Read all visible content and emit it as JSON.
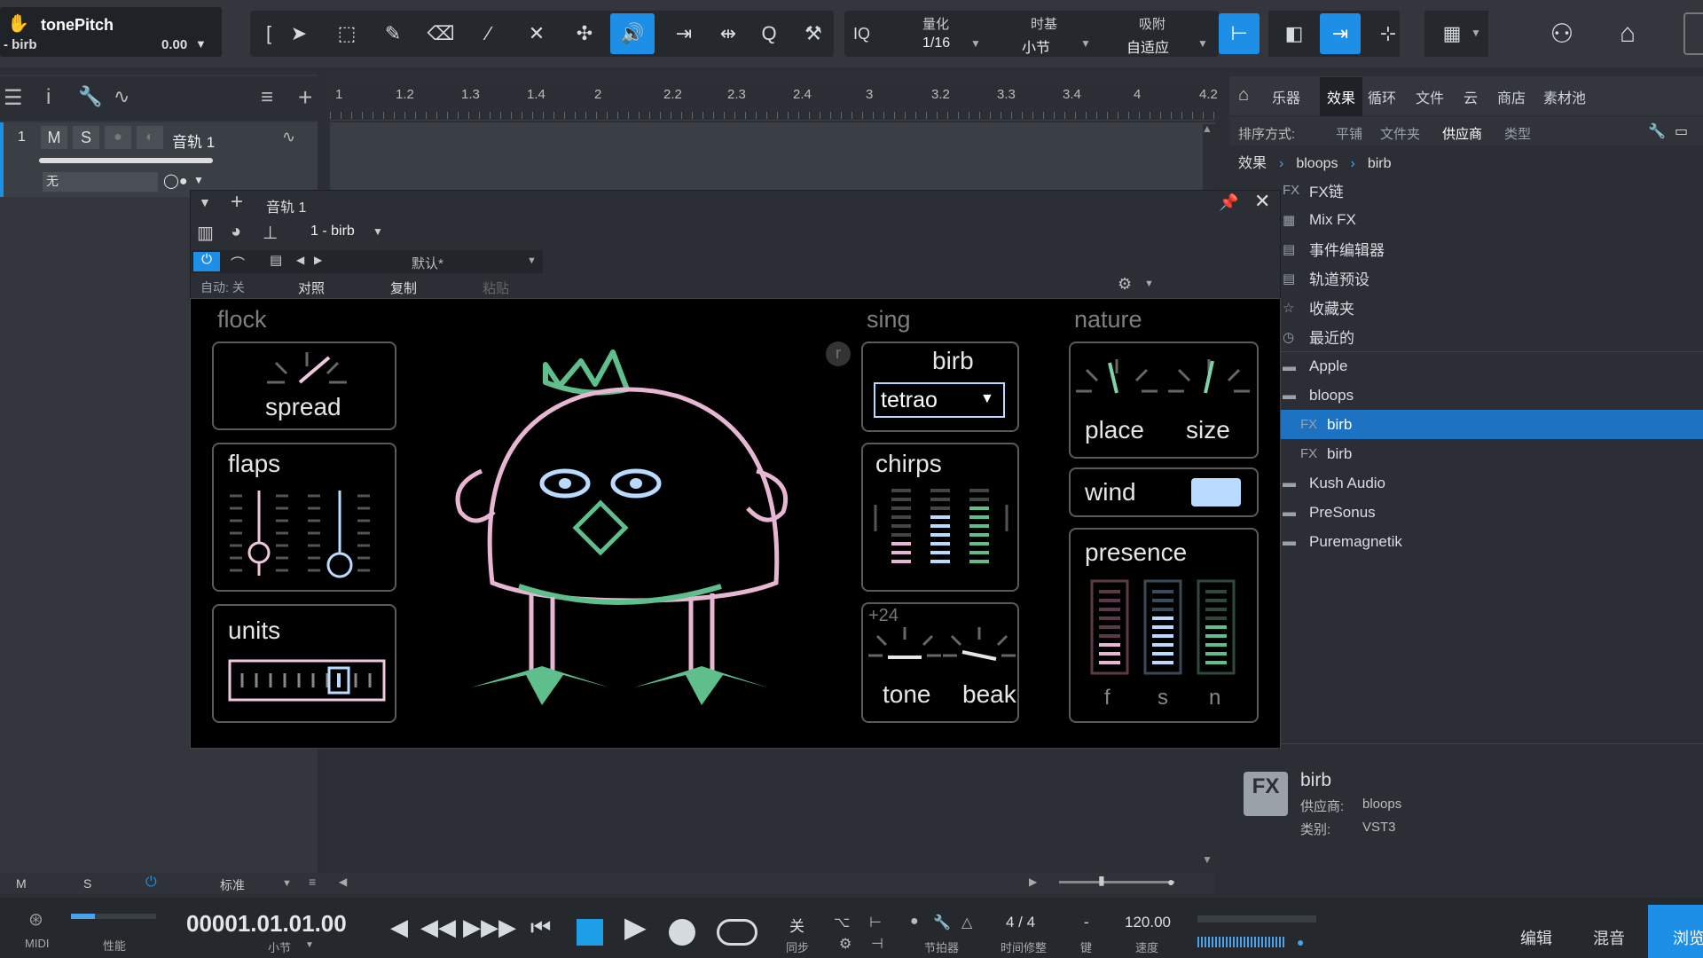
{
  "track_header": {
    "title": "tonePitch",
    "subtitle": "- birb",
    "value": "0.00"
  },
  "toolbar": {
    "quantize_label": "量化",
    "quantize_value": "1/16",
    "timebase_label": "时基",
    "timebase_value": "小节",
    "snap_label": "吸附",
    "snap_value": "自适应",
    "iq": "IQ"
  },
  "ruler": [
    "1",
    "1.2",
    "1.3",
    "1.4",
    "2",
    "2.2",
    "2.3",
    "2.4",
    "3",
    "3.2",
    "3.3",
    "3.4",
    "4",
    "4.2"
  ],
  "track": {
    "number": "1",
    "m": "M",
    "s": "S",
    "name": "音轨 1",
    "input": "无"
  },
  "browser": {
    "tabs": [
      "乐器",
      "效果",
      "循环",
      "文件",
      "云",
      "商店",
      "素材池"
    ],
    "sort_label": "排序方式:",
    "sort_options": [
      "平铺",
      "文件夹",
      "供应商",
      "类型"
    ],
    "breadcrumb": [
      "效果",
      "bloops",
      "birb"
    ],
    "items": [
      {
        "icon": "FX",
        "label": "FX链"
      },
      {
        "icon": "▦",
        "label": "Mix FX"
      },
      {
        "icon": "▤",
        "label": "事件编辑器"
      },
      {
        "icon": "▤",
        "label": "轨道预设"
      },
      {
        "icon": "☆",
        "label": "收藏夹"
      },
      {
        "icon": "◷",
        "label": "最近的"
      },
      {
        "icon": "▬",
        "label": "Apple"
      },
      {
        "icon": "▬",
        "label": "bloops"
      },
      {
        "icon": "FX",
        "label": "birb"
      },
      {
        "icon": "FX",
        "label": "birb"
      },
      {
        "icon": "▬",
        "label": "Kush Audio"
      },
      {
        "icon": "▬",
        "label": "PreSonus"
      },
      {
        "icon": "▬",
        "label": "Puremagnetik"
      }
    ],
    "info": {
      "icon": "FX",
      "name": "birb",
      "vendor_label": "供应商:",
      "vendor": "bloops",
      "type_label": "类别:",
      "type": "VST3"
    }
  },
  "plugin_window": {
    "title": "音轨 1",
    "preset_slot": "1 - birb",
    "preset_name": "默认*",
    "auto_label": "自动: 关",
    "compare": "对照",
    "copy": "复制",
    "paste": "粘贴"
  },
  "birb": {
    "flock": "flock",
    "spread": "spread",
    "flaps": "flaps",
    "units": "units",
    "sing": "sing",
    "birb": "birb",
    "species": "tetrao",
    "chirps": "chirps",
    "offset": "+24",
    "tone": "tone",
    "beak": "beak",
    "nature": "nature",
    "place": "place",
    "size": "size",
    "wind": "wind",
    "presence": "presence",
    "f": "f",
    "s": "s",
    "n": "n",
    "r": "r"
  },
  "bottom_track_bar": {
    "m": "M",
    "s": "S",
    "mode": "标准"
  },
  "transport": {
    "midi": "MIDI",
    "perf": "性能",
    "position": "00001.01.01.00",
    "position_unit": "小节",
    "sync_value": "关",
    "sync_label": "同步",
    "metronome_label": "节拍器",
    "signature": "4 / 4",
    "signature_label": "时间修整",
    "key_value": "-",
    "key_label": "键",
    "tempo": "120.00",
    "tempo_label": "速度",
    "edit": "编辑",
    "mix": "混音",
    "browse": "浏览"
  },
  "colors": {
    "accent": "#1e8fe6",
    "pink": "#e7b6d2",
    "blue": "#b9dbff",
    "green": "#5fbf8c"
  }
}
